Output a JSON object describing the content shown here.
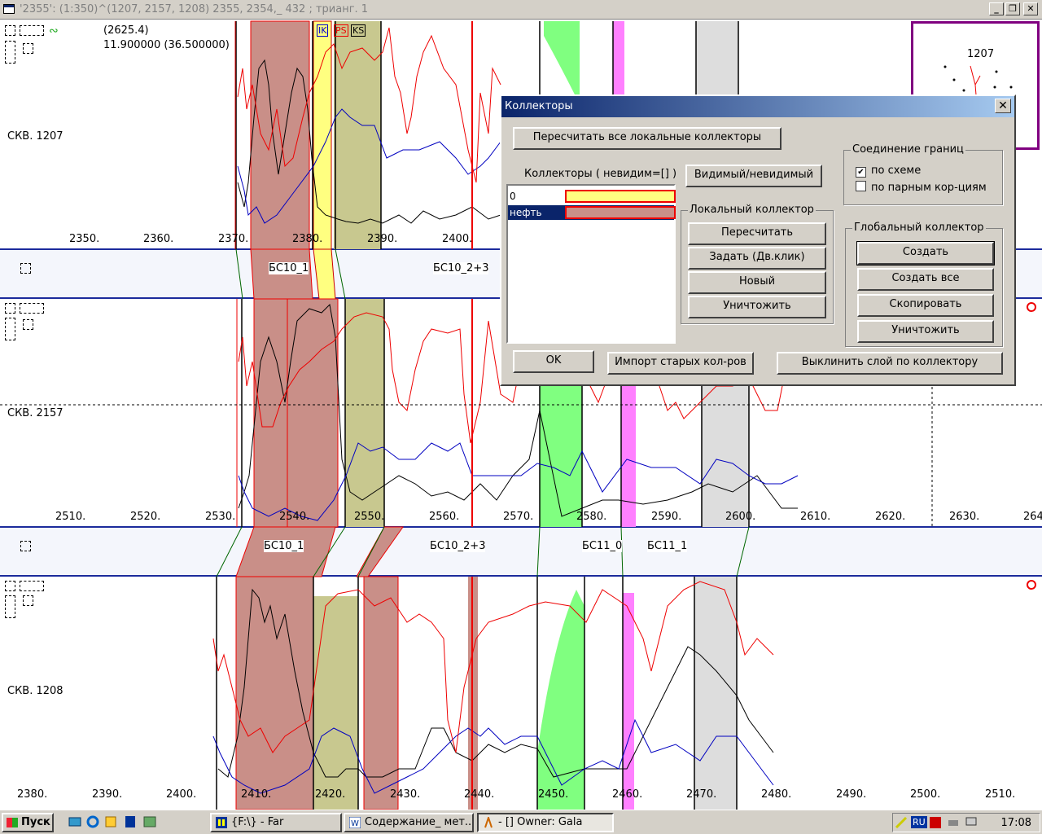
{
  "window": {
    "title": "'2355': (1:350)^(1207, 2157, 1208) 2355, 2354,_ 432 ; трианг. 1",
    "min": "_",
    "max": "❐",
    "close": "✕"
  },
  "header_info": {
    "value1": "(2625.4)",
    "value2": "11.900000 (36.500000)",
    "curve_buttons": [
      "IK",
      "PS",
      "KS"
    ]
  },
  "wells": [
    {
      "name": "СКВ. 1207",
      "depth_ticks": [
        "2350.",
        "2360.",
        "2370.",
        "2380.",
        "2390.",
        "2400."
      ]
    },
    {
      "name": "СКВ. 2157",
      "depth_ticks": [
        "2510.",
        "2520.",
        "2530.",
        "2540.",
        "2550.",
        "2560.",
        "2570.",
        "2580.",
        "2590.",
        "2600.",
        "2610.",
        "2620.",
        "2630.",
        "264"
      ]
    },
    {
      "name": "СКВ. 1208",
      "depth_ticks": [
        "2380.",
        "2390.",
        "2400.",
        "2410.",
        "2420.",
        "2430.",
        "2440.",
        "2450.",
        "2460.",
        "2470.",
        "2480.",
        "2490.",
        "2500.",
        "2510."
      ]
    }
  ],
  "formations_top": [
    "БС10_1",
    "БС10_2+3"
  ],
  "formations_bottom": [
    "БС10_1",
    "БС10_2+3",
    "БС11_0",
    "БС11_1"
  ],
  "minimap": {
    "label": "1207"
  },
  "dialog": {
    "title": "Коллекторы",
    "close": "✕",
    "recalc_all": "Пересчитать все локальные коллекторы",
    "list_header": "Коллекторы ( невидим=[] )",
    "visible_toggle": "Видимый/невидимый",
    "items": [
      {
        "label": "0",
        "color": "#ffff80",
        "selected": false
      },
      {
        "label": "нефть",
        "color": "#c98f88",
        "selected": true
      }
    ],
    "connect_group": {
      "title": "Соединение границ",
      "options": [
        {
          "label": "по схеме",
          "checked": true
        },
        {
          "label": "по парным кор-циям",
          "checked": false
        }
      ]
    },
    "local_group": {
      "title": "Локальный коллектор",
      "buttons": [
        "Пересчитать",
        "Задать (Дв.клик)",
        "Новый",
        "Уничтожить"
      ]
    },
    "global_group": {
      "title": "Глобальный коллектор",
      "buttons": [
        "Создать",
        "Создать все",
        "Скопировать",
        "Уничтожить"
      ]
    },
    "ok": "OK",
    "import": "Импорт старых кол-ров",
    "shift_layer": "Выклинить слой по коллектору"
  },
  "taskbar": {
    "start": "Пуск",
    "tasks": [
      "{F:\\} - Far",
      "Содержание_ мет...",
      "- [] Owner: Gala"
    ],
    "lang": "RU",
    "time": "17:08"
  },
  "colors": {
    "oil": "#c98f88",
    "yellow": "#ffff80",
    "olive": "#c8c88f",
    "green": "#80ff80",
    "magenta": "#ff80ff",
    "gray": "#dddddd",
    "curve_red": "#e00000",
    "curve_blue": "#0000c0",
    "border_blue": "#1c2b9c"
  }
}
